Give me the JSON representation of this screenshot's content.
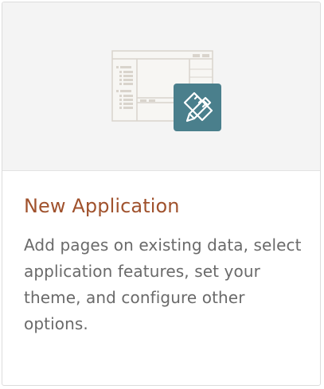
{
  "card": {
    "title": "New Application",
    "description": "Add pages on existing data, select application features, set your theme, and configure other options.",
    "icon": "app-builder-ruler-pencil-icon"
  },
  "colors": {
    "title": "#a0522d",
    "text": "#6a6a6a",
    "icon_tile": "#4a7f8c",
    "media_bg": "#f4f4f4"
  }
}
